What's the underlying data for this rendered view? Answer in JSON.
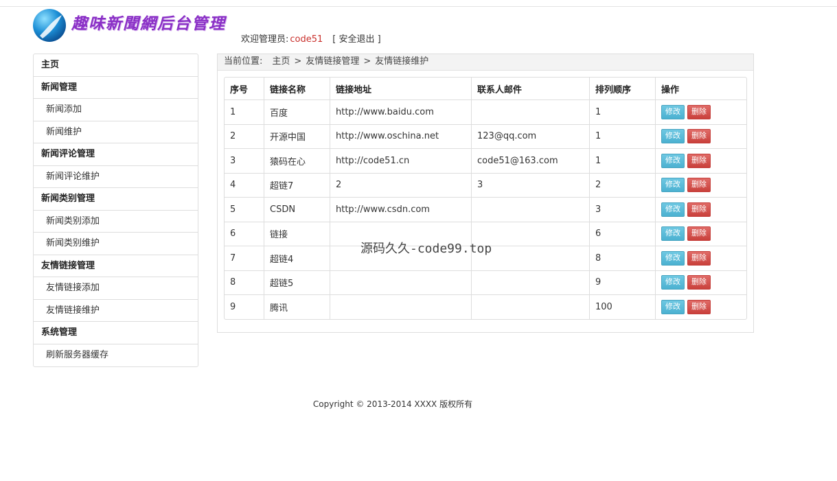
{
  "header": {
    "logo_text": "趣味新聞網后台管理",
    "welcome_label": "欢迎管理员:",
    "username": "code51",
    "logout_label": "[ 安全退出 ]"
  },
  "sidebar": {
    "items": [
      {
        "label": "主页",
        "type": "head"
      },
      {
        "label": "新闻管理",
        "type": "head"
      },
      {
        "label": "新闻添加",
        "type": "sub"
      },
      {
        "label": "新闻维护",
        "type": "sub"
      },
      {
        "label": "新闻评论管理",
        "type": "head"
      },
      {
        "label": "新闻评论维护",
        "type": "sub"
      },
      {
        "label": "新闻类别管理",
        "type": "head"
      },
      {
        "label": "新闻类别添加",
        "type": "sub"
      },
      {
        "label": "新闻类别维护",
        "type": "sub"
      },
      {
        "label": "友情链接管理",
        "type": "head"
      },
      {
        "label": "友情链接添加",
        "type": "sub"
      },
      {
        "label": "友情链接维护",
        "type": "sub"
      },
      {
        "label": "系统管理",
        "type": "head"
      },
      {
        "label": "刷新服务器缓存",
        "type": "sub"
      }
    ]
  },
  "breadcrumb": {
    "label": "当前位置:",
    "items": [
      "主页",
      "友情链接管理",
      "友情链接维护"
    ],
    "separator": ">"
  },
  "table": {
    "headers": [
      "序号",
      "链接名称",
      "链接地址",
      "联系人邮件",
      "排列顺序",
      "操作"
    ],
    "edit_label": "修改",
    "delete_label": "删除",
    "rows": [
      [
        "1",
        "百度",
        "http://www.baidu.com",
        "",
        "1"
      ],
      [
        "2",
        "开源中国",
        "http://www.oschina.net",
        "123@qq.com",
        "1"
      ],
      [
        "3",
        "猿码在心",
        "http://code51.cn",
        "code51@163.com",
        "1"
      ],
      [
        "4",
        "超链7",
        "2",
        "3",
        "2"
      ],
      [
        "5",
        "CSDN",
        "http://www.csdn.com",
        "",
        "3"
      ],
      [
        "6",
        "链接",
        "",
        "",
        "6"
      ],
      [
        "7",
        "超链4",
        "",
        "",
        "8"
      ],
      [
        "8",
        "超链5",
        "",
        "",
        "9"
      ],
      [
        "9",
        "腾讯",
        "",
        "",
        "100"
      ]
    ]
  },
  "watermark": "源码久久-code99.top",
  "footer": "Copyright © 2013-2014 XXXX 版权所有",
  "colors": {
    "edit_button": "#5bc0de",
    "delete_button": "#d9534f",
    "username": "#c9302c",
    "logo_text": "#8a2fc6"
  }
}
